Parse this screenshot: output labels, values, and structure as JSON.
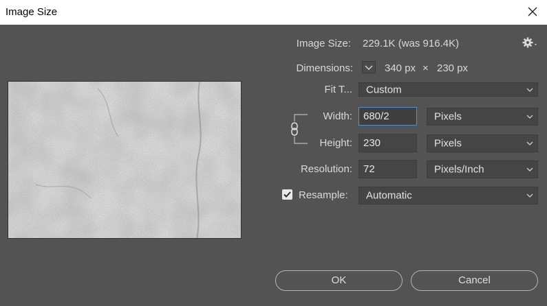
{
  "window": {
    "title": "Image Size"
  },
  "image_size": {
    "label": "Image Size:",
    "value": "229.1K (was 916.4K)"
  },
  "dimensions": {
    "label": "Dimensions:",
    "width": "340 px",
    "times": "×",
    "height": "230 px"
  },
  "fit_to": {
    "label": "Fit T...",
    "value": "Custom"
  },
  "width": {
    "label": "Width:",
    "value": "680/2",
    "unit": "Pixels"
  },
  "height": {
    "label": "Height:",
    "value": "230",
    "unit": "Pixels"
  },
  "resolution": {
    "label": "Resolution:",
    "value": "72",
    "unit": "Pixels/Inch"
  },
  "resample": {
    "label": "Resample:",
    "value": "Automatic",
    "checked": true
  },
  "buttons": {
    "ok": "OK",
    "cancel": "Cancel"
  },
  "icons": {
    "close": "close-icon",
    "gear": "gear-icon",
    "link": "chain-link-icon",
    "check": "checkmark-icon"
  },
  "colors": {
    "background": "#535353",
    "accent": "#5a8fd4"
  }
}
